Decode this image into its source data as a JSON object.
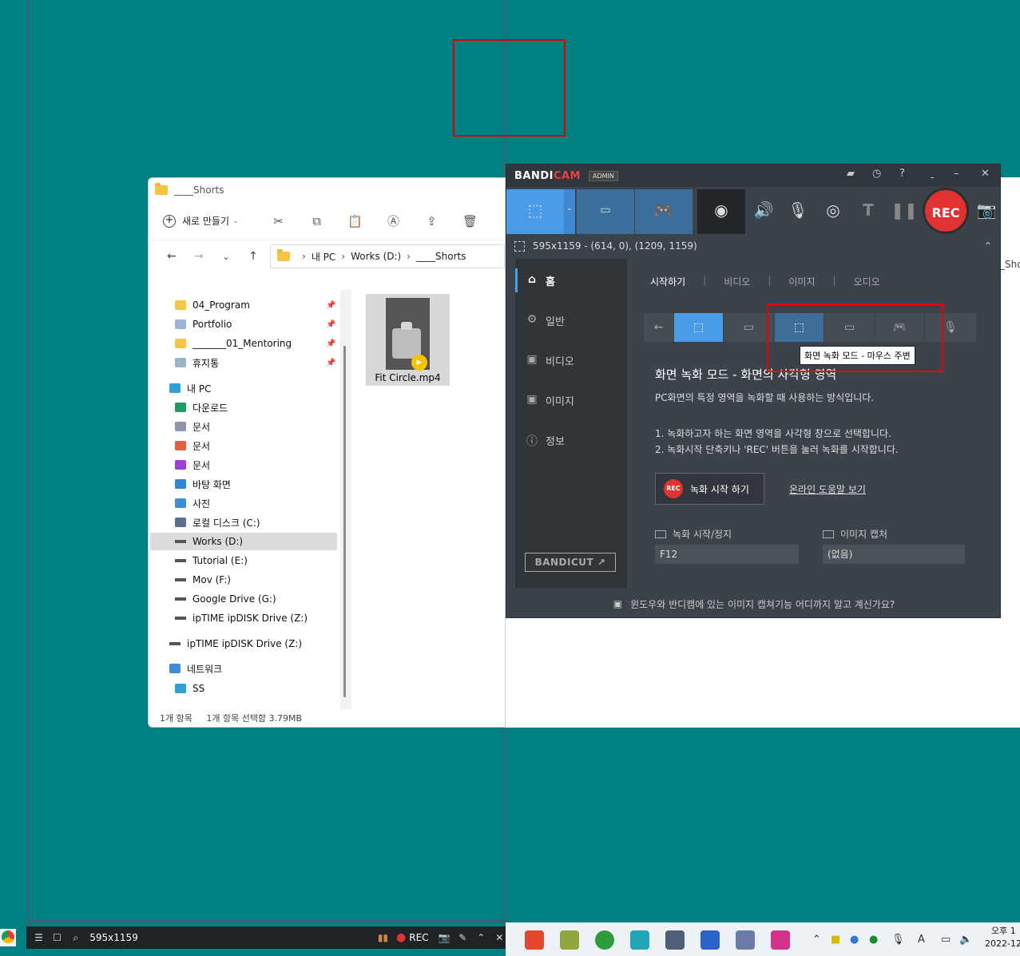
{
  "selection_lines": true,
  "explorer": {
    "title": "____Shorts",
    "toolbar": {
      "new_label": "새로 만들기"
    },
    "breadcrumb": [
      "내 PC",
      "Works (D:)",
      "____Shorts"
    ],
    "tree": [
      {
        "label": "04_Program",
        "icon": "folder",
        "pinned": true
      },
      {
        "label": "Portfolio",
        "icon": "user-folder",
        "pinned": true
      },
      {
        "label": "_______01_Mentoring",
        "icon": "folder",
        "pinned": true
      },
      {
        "label": "휴지통",
        "icon": "recycle-bin",
        "pinned": true
      },
      {
        "label": "내 PC",
        "icon": "pc"
      },
      {
        "label": "다운로드",
        "icon": "download"
      },
      {
        "label": "문서",
        "icon": "document"
      },
      {
        "label": "문서",
        "icon": "music"
      },
      {
        "label": "문서",
        "icon": "video"
      },
      {
        "label": "바탕 화면",
        "icon": "desktop"
      },
      {
        "label": "사진",
        "icon": "pictures"
      },
      {
        "label": "로컬 디스크 (C:)",
        "icon": "windows-drive"
      },
      {
        "label": "Works (D:)",
        "icon": "drive",
        "selected": true
      },
      {
        "label": "Tutorial (E:)",
        "icon": "drive"
      },
      {
        "label": "Mov (F:)",
        "icon": "drive"
      },
      {
        "label": "Google Drive (G:)",
        "icon": "drive"
      },
      {
        "label": "ipTIME ipDISK Drive (Z:)",
        "icon": "drive"
      },
      {
        "label": "ipTIME ipDISK Drive (Z:)",
        "icon": "drive"
      },
      {
        "label": "네트워크",
        "icon": "network"
      },
      {
        "label": "SS",
        "icon": "pc"
      }
    ],
    "file": {
      "name": "Fit Circle.mp4"
    },
    "status": {
      "count": "1개 항목",
      "selected": "1개 항목 선택함 3.79MB"
    }
  },
  "shorts_fragment": "_Sho",
  "bandicam": {
    "logo_a": "BANDI",
    "logo_b": "CAM",
    "admin": "ADMIN",
    "rec_label": "REC",
    "region_info": "595x1159 - (614, 0), (1209, 1159)",
    "sidebar": [
      {
        "label": "홈",
        "icon": "home-icon"
      },
      {
        "label": "일반",
        "icon": "gear-icon"
      },
      {
        "label": "비디오",
        "icon": "video-settings-icon"
      },
      {
        "label": "이미지",
        "icon": "image-settings-icon"
      },
      {
        "label": "정보",
        "icon": "info-icon"
      }
    ],
    "bandicut": "BANDICUT ↗",
    "tabs": [
      "시작하기",
      "비디오",
      "이미지",
      "오디오"
    ],
    "tooltip": "화면 녹화 모드 - 마우스 주변",
    "mode_title": "화면 녹화 모드 - 화면의 사각형 영역",
    "mode_desc": "PC화면의 특정 영역을 녹화할 때 사용하는 방식입니다.",
    "step1": "1. 녹화하고자 하는 화면 영역을 사각형 창으로 선택합니다.",
    "step2": "2. 녹화시작 단축키나 'REC' 버튼을 눌러 녹화를 시작합니다.",
    "start_btn": "녹화 시작 하기",
    "start_btn_icon": "REC",
    "help_link": "온라인 도움말 보기",
    "hotkey_record_label": "녹화 시작/정지",
    "hotkey_record_value": "F12",
    "hotkey_capture_label": "이미지 캡처",
    "hotkey_capture_value": "(없음)",
    "footer": "윈도우와 반디캠에 있는 이미지 캡쳐기능 어디까지 알고 계신가요?"
  },
  "capture_bar": {
    "size": "595x1159",
    "rec": "REC"
  },
  "taskbar": {
    "time": "오후 1",
    "date": "2022-12"
  },
  "colors": {
    "desktop": "#008080",
    "accent": "#4a9be8",
    "rec_red": "#e23131"
  }
}
